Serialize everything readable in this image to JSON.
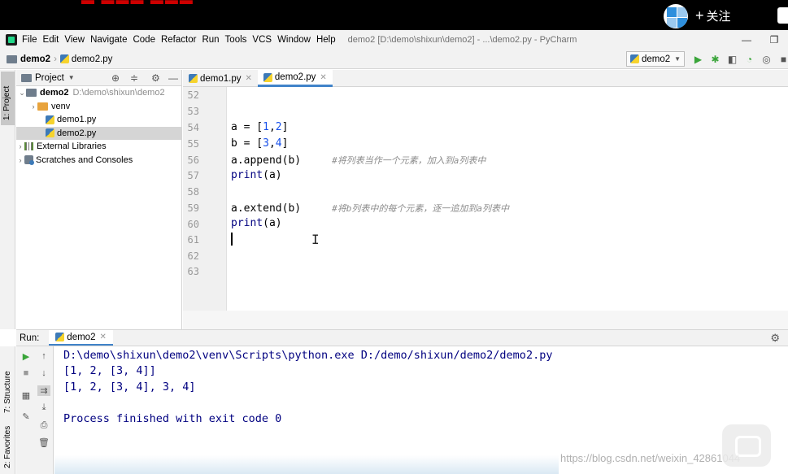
{
  "overlay": {
    "follow_label": "关注",
    "plus_glyph": "+"
  },
  "menubar": {
    "items": [
      "File",
      "Edit",
      "View",
      "Navigate",
      "Code",
      "Refactor",
      "Run",
      "Tools",
      "VCS",
      "Window",
      "Help"
    ],
    "window_title": "demo2 [D:\\demo\\shixun\\demo2] - ...\\demo2.py - PyCharm"
  },
  "navbar": {
    "project": "demo2",
    "file": "demo2.py",
    "run_config": "demo2"
  },
  "sidebar": {
    "project_tab": "1: Project",
    "structure_tab": "7: Structure",
    "favorites_tab": "2: Favorites"
  },
  "project": {
    "header": "Project",
    "root_name": "demo2",
    "root_path": "D:\\demo\\shixun\\demo2",
    "venv": "venv",
    "file1": "demo1.py",
    "file2": "demo2.py",
    "ext_libs": "External Libraries",
    "scratches": "Scratches and Consoles"
  },
  "editor": {
    "tabs": [
      "demo1.py",
      "demo2.py"
    ],
    "line_numbers": [
      "52",
      "53",
      "54",
      "55",
      "56",
      "57",
      "58",
      "59",
      "60",
      "61",
      "62",
      "63"
    ],
    "code": {
      "l54_a": "a = [",
      "l54_n1": "1",
      "l54_c": ",",
      "l54_n2": "2",
      "l54_e": "]",
      "l55_a": "b = [",
      "l55_n1": "3",
      "l55_c": ",",
      "l55_n2": "4",
      "l55_e": "]",
      "l56": "a.append(b)",
      "l56_comment": "#将列表当作一个元素，加入到a列表中",
      "l57_kw": "print",
      "l57_rest": "(a)",
      "l59": "a.extend(b)",
      "l59_comment": "#将b列表中的每个元素，逐一追加到a列表中",
      "l60_kw": "print",
      "l60_rest": "(a)"
    }
  },
  "run": {
    "label": "Run:",
    "tab": "demo2",
    "output": [
      "D:\\demo\\shixun\\demo2\\venv\\Scripts\\python.exe D:/demo/shixun/demo2/demo2.py",
      "[1, 2, [3, 4]]",
      "[1, 2, [3, 4], 3, 4]",
      "",
      "Process finished with exit code 0"
    ]
  },
  "watermark": "https://blog.csdn.net/weixin_42861044",
  "colors": {
    "accent": "#4083c9",
    "number": "#1750eb",
    "keyword": "#000080",
    "comment": "#8c8c8c",
    "console_text": "#000080"
  }
}
